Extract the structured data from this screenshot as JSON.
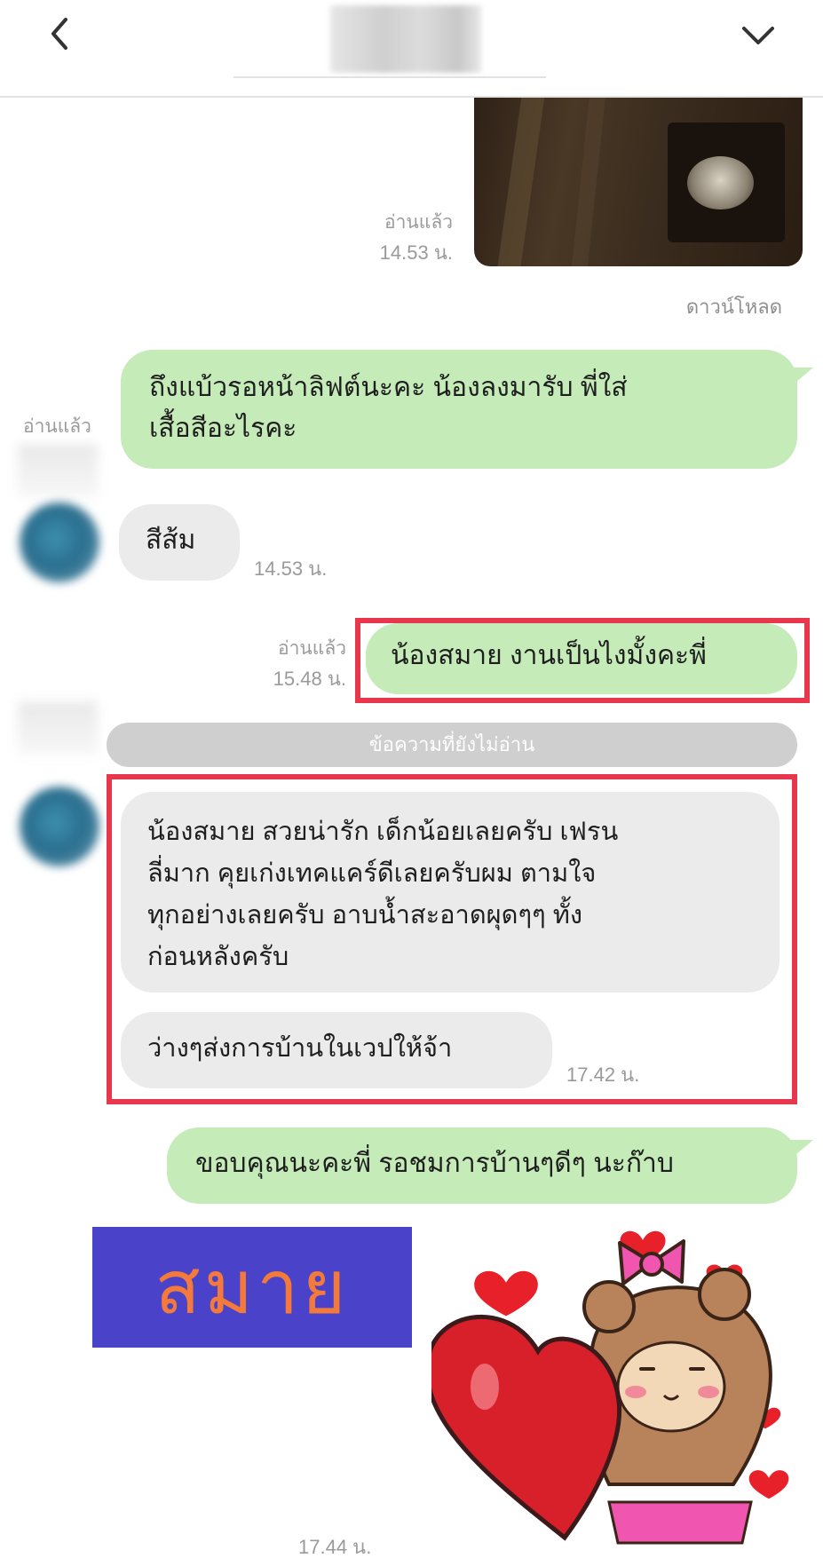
{
  "header": {
    "back_icon": "chevron-left-icon",
    "collapse_icon": "chevron-down-icon"
  },
  "photo_message": {
    "read_status": "อ่านแล้ว",
    "time": "14.53 น.",
    "download_label": "ดาวน์โหลด"
  },
  "messages": [
    {
      "id": "m1",
      "side": "out",
      "text_lines": [
        "ถึงแบ้วรอหน้าลิฟต์นะคะ น้องลงมารับ พี่ใส่",
        "เสื้อสีอะไรคะ"
      ],
      "read_status": "อ่านแล้ว"
    },
    {
      "id": "m2",
      "side": "in",
      "text": "สีส้ม",
      "time": "14.53 น."
    },
    {
      "id": "m3",
      "side": "out",
      "text": "น้องสมาย งานเป็นไงมั้งคะพี่",
      "read_status": "อ่านแล้ว",
      "time": "15.48 น."
    },
    {
      "id": "m4",
      "side": "in",
      "text_lines": [
        "น้องสมาย สวยน่ารัก เด็กน้อยเลยครับ  เฟรน",
        "ลี่มาก คุยเก่งเทคแคร์ดีเลยครับผม ตามใจ",
        "ทุกอย่างเลยครับ  อาบน้ำสะอาดผุดๆๆ ทั้ง",
        "ก่อนหลังครับ"
      ]
    },
    {
      "id": "m5",
      "side": "in",
      "text": "ว่างๆส่งการบ้านในเวปให้จ้า",
      "time": "17.42 น."
    },
    {
      "id": "m6",
      "side": "out",
      "text": "ขอบคุณนะคะพี่ รอชมการบ้านๆดีๆ นะก๊าบ"
    }
  ],
  "unread_divider": "ข้อความที่ยังไม่อ่าน",
  "overlay_label": "สมาย",
  "sticker": {
    "icon": "heart-bear-sticker",
    "time": "17.44 น."
  },
  "colors": {
    "outgoing_bubble": "#c5ebb9",
    "incoming_bubble": "#ebebeb",
    "highlight_box": "#e8364d",
    "label_bg": "#4a42c8",
    "label_text": "#f47a3c"
  }
}
